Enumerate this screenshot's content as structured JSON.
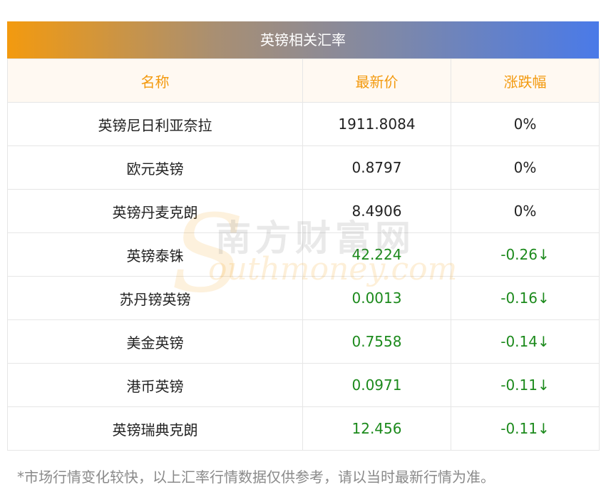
{
  "table": {
    "title": "英镑相关汇率",
    "headers": [
      "名称",
      "最新价",
      "涨跌幅"
    ],
    "rows": [
      {
        "name": "英镑尼日利亚奈拉",
        "price": "1911.8084",
        "change": "0%",
        "trend": "flat"
      },
      {
        "name": "欧元英镑",
        "price": "0.8797",
        "change": "0%",
        "trend": "flat"
      },
      {
        "name": "英镑丹麦克朗",
        "price": "8.4906",
        "change": "0%",
        "trend": "flat"
      },
      {
        "name": "英镑泰铢",
        "price": "42.224",
        "change": "-0.26↓",
        "trend": "down"
      },
      {
        "name": "苏丹镑英镑",
        "price": "0.0013",
        "change": "-0.16↓",
        "trend": "down"
      },
      {
        "name": "美金英镑",
        "price": "0.7558",
        "change": "-0.14↓",
        "trend": "down"
      },
      {
        "name": "港币英镑",
        "price": "0.0971",
        "change": "-0.11↓",
        "trend": "down"
      },
      {
        "name": "英镑瑞典克朗",
        "price": "12.456",
        "change": "-0.11↓",
        "trend": "down"
      }
    ]
  },
  "note": "*市场行情变化较快，以上汇率行情数据仅供参考，请以当时最新行情为准。",
  "watermark": {
    "initial": "S",
    "cn": "南方财富网",
    "en": "outhmoney.com"
  },
  "colors": {
    "accent": "#f39a0f",
    "down": "#1c8a1c",
    "banner_end": "#4a7ae8"
  }
}
